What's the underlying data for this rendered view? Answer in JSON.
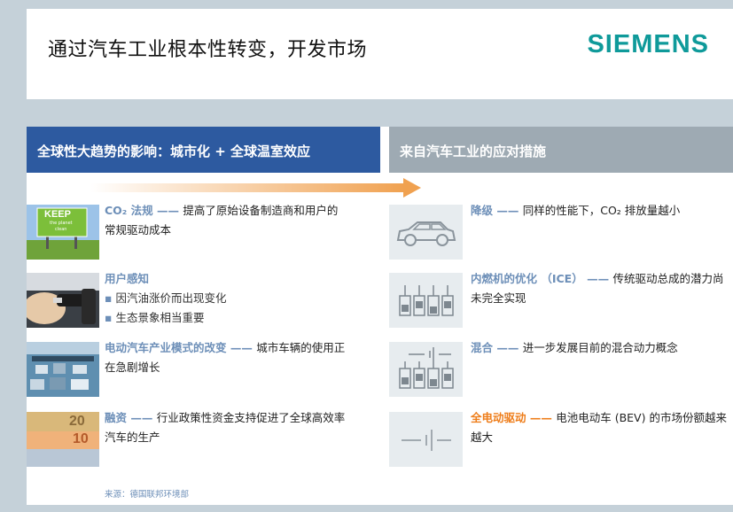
{
  "header": {
    "title": "通过汽车工业根本性转变，开发市场",
    "logo": "SIEMENS"
  },
  "left_panel": {
    "heading": "全球性大趋势的影响：城市化 + 全球温室效应",
    "items": [
      {
        "keyword": "CO₂ 法规",
        "dash": " —— ",
        "text": "提高了原始设备制造商和用户的常规驱动成本",
        "image_text": [
          "KEEP",
          "the planet",
          "clean"
        ]
      },
      {
        "keyword": "用户感知",
        "bullets": [
          "因汽油涨价而出现变化",
          "生态景象相当重要"
        ]
      },
      {
        "keyword": "电动汽车产业模式的改变",
        "dash": " —— ",
        "text": "城市车辆的使用正在急剧增长"
      },
      {
        "keyword": "融资",
        "dash": " —— ",
        "text": "行业政策性资金支持促进了全球高效率汽车的生产",
        "image_text": [
          "20",
          "10"
        ]
      }
    ],
    "source": "来源：德国联邦环境部"
  },
  "right_panel": {
    "heading": "来自汽车工业的应对措施",
    "items": [
      {
        "keyword": "降级",
        "dash": " —— ",
        "text": "同样的性能下，CO₂ 排放量越小"
      },
      {
        "keyword": "内燃机的优化 （ICE）",
        "dash": " —— ",
        "text": "传统驱动总成的潜力尚未完全实现"
      },
      {
        "keyword": "混合",
        "dash": " —— ",
        "text": "进一步发展目前的混合动力概念"
      },
      {
        "keyword": "全电动驱动",
        "dash": " —— ",
        "text": "电池电动车 (BEV) 的市场份额越来越大"
      }
    ]
  },
  "colors": {
    "left_header": "#2d5aa0",
    "right_header": "#9eaab3",
    "keyword": "#6d8fb8",
    "highlight": "#ee7d1a",
    "logo": "#0f9a9a"
  }
}
